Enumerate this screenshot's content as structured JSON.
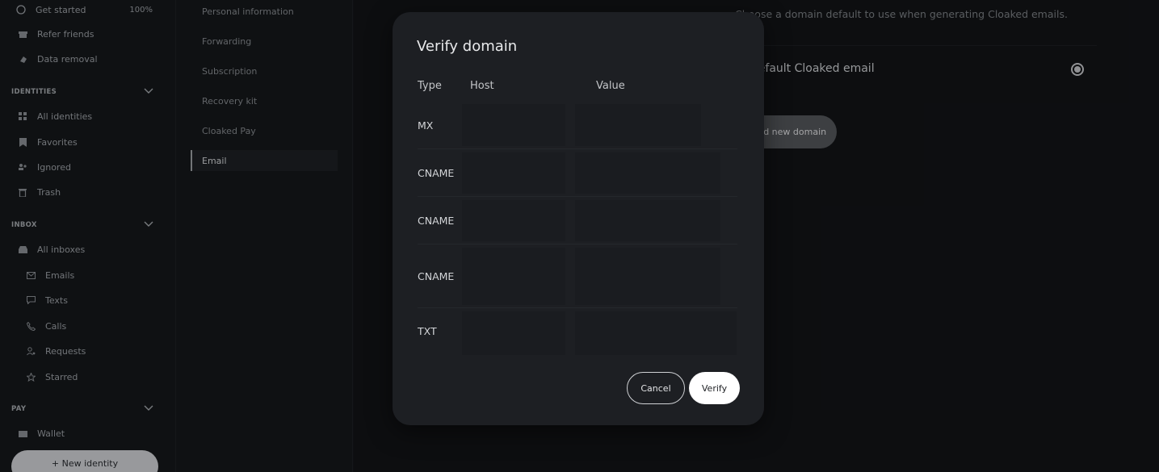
{
  "sidebar": {
    "get_started": {
      "label": "Get started",
      "progress": "100%"
    },
    "refer_friends": "Refer friends",
    "data_removal": "Data removal",
    "identities_section": "IDENTITIES",
    "all_identities": "All identities",
    "favorites": "Favorites",
    "ignored": "Ignored",
    "trash": "Trash",
    "inbox_section": "INBOX",
    "all_inboxes": "All inboxes",
    "emails": "Emails",
    "texts": "Texts",
    "calls": "Calls",
    "requests": "Requests",
    "starred": "Starred",
    "pay_section": "PAY",
    "wallet": "Wallet",
    "new_identity": "+ New identity"
  },
  "settings_nav": {
    "items": [
      "Personal information",
      "Forwarding",
      "Subscription",
      "Recovery kit",
      "Cloaked Pay",
      "Email"
    ],
    "active": "Email"
  },
  "main": {
    "description": "Choose a domain default to use when generating Cloaked emails.",
    "default_label": "Default Cloaked email",
    "add_domain": "Add new domain"
  },
  "modal": {
    "title": "Verify domain",
    "headers": {
      "type": "Type",
      "host": "Host",
      "value": "Value"
    },
    "records": [
      "MX",
      "CNAME",
      "CNAME",
      "CNAME",
      "TXT"
    ],
    "cancel": "Cancel",
    "verify": "Verify"
  }
}
